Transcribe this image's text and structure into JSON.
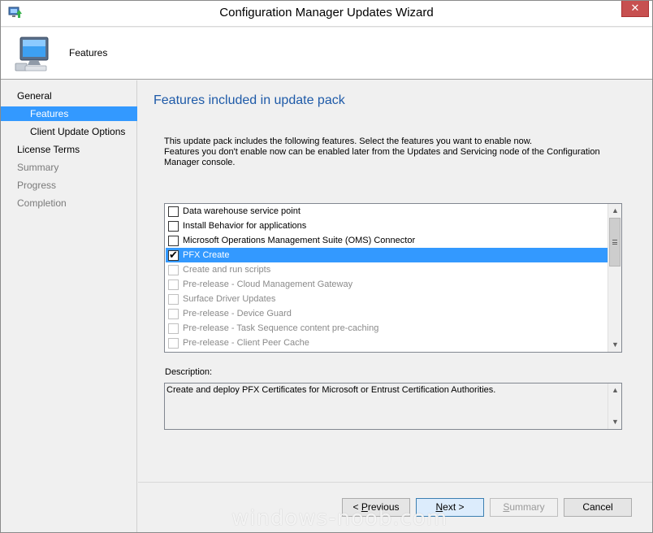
{
  "window": {
    "title": "Configuration Manager Updates Wizard",
    "close_glyph": "✕"
  },
  "header": {
    "title": "Features",
    "icon": "computer-icon"
  },
  "nav": {
    "items": [
      {
        "label": "General",
        "state": "normal"
      },
      {
        "label": "Features",
        "state": "selected"
      },
      {
        "label": "Client Update Options",
        "state": "normal"
      },
      {
        "label": "License Terms",
        "state": "normal"
      },
      {
        "label": "Summary",
        "state": "disabled"
      },
      {
        "label": "Progress",
        "state": "disabled"
      },
      {
        "label": "Completion",
        "state": "disabled"
      }
    ]
  },
  "main": {
    "title": "Features included in update pack",
    "intro_line1": "This update pack includes the following features. Select the features you want to enable now.",
    "intro_line2": "Features you don't enable now can be enabled later from the Updates and Servicing node of the Configuration Manager console.",
    "features": [
      {
        "label": "Data warehouse service point",
        "checked": false,
        "enabled": true
      },
      {
        "label": "Install Behavior for applications",
        "checked": false,
        "enabled": true
      },
      {
        "label": "Microsoft Operations Management Suite (OMS) Connector",
        "checked": false,
        "enabled": true
      },
      {
        "label": "PFX Create",
        "checked": true,
        "enabled": true
      },
      {
        "label": "Create and run scripts",
        "checked": false,
        "enabled": false
      },
      {
        "label": "Pre-release - Cloud Management Gateway",
        "checked": false,
        "enabled": false
      },
      {
        "label": "Surface Driver Updates",
        "checked": false,
        "enabled": false
      },
      {
        "label": "Pre-release - Device Guard",
        "checked": false,
        "enabled": false
      },
      {
        "label": "Pre-release - Task Sequence content pre-caching",
        "checked": false,
        "enabled": false
      },
      {
        "label": "Pre-release - Client Peer Cache",
        "checked": false,
        "enabled": false
      }
    ],
    "check_glyph": "✔",
    "scroll_up_glyph": "▲",
    "scroll_down_glyph": "▼",
    "description_label": "Description:",
    "description_text": "Create and deploy PFX Certificates for Microsoft or Entrust Certification Authorities."
  },
  "footer": {
    "previous_prefix": "< ",
    "previous_key": "P",
    "previous_rest": "revious",
    "next_key": "N",
    "next_rest": "ext >",
    "summary_key": "S",
    "summary_rest": "ummary",
    "cancel_label": "Cancel"
  },
  "watermark": "windows-noob.com"
}
